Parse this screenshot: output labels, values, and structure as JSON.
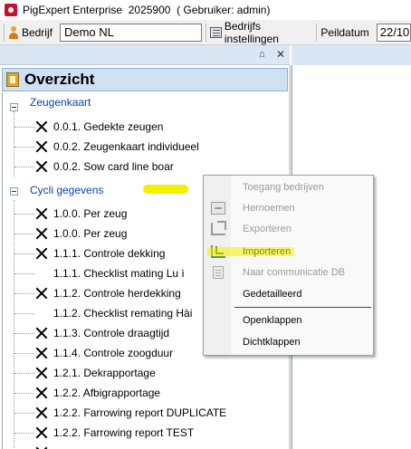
{
  "window": {
    "title": "PigExpert Enterprise  2025900  ( Gebruiker: admin)"
  },
  "toolbar": {
    "company_label": "Bedrijf",
    "company_value": "Demo NL",
    "settings_label": "Bedrijfs instellingen",
    "date_label": "Peildatum",
    "date_value": "22/10"
  },
  "panel": {
    "pin_glyph": "⌂",
    "close_glyph": "✕",
    "title": "Overzicht"
  },
  "tree": {
    "groups": [
      {
        "label": "Zeugenkaart",
        "items": [
          {
            "label": "0.0.1. Gedekte zeugen",
            "icon": "x-icon"
          },
          {
            "label": "0.0.2. Zeugenkaart individueel",
            "icon": "x-icon"
          },
          {
            "label": "0.0.2. Sow card line boar",
            "icon": "x-icon"
          }
        ]
      },
      {
        "label": "Cycli gegevens",
        "items": [
          {
            "label": "1.0.0. Per zeug",
            "icon": "x-icon"
          },
          {
            "label": "1.0.0. Per zeug",
            "icon": "x-icon"
          },
          {
            "label": "1.1.1. Controle dekking",
            "icon": "x-icon"
          },
          {
            "label": "1.1.1. Checklist mating Lu ì",
            "icon": "none"
          },
          {
            "label": "1.1.2. Controle herdekking",
            "icon": "x-icon"
          },
          {
            "label": "1.1.2. Checklist remating Hài",
            "icon": "none"
          },
          {
            "label": "1.1.3. Controle draagtijd",
            "icon": "x-icon"
          },
          {
            "label": "1.1.4. Controle zoogduur",
            "icon": "x-icon"
          },
          {
            "label": "1.2.1. Dekrapportage",
            "icon": "x-icon"
          },
          {
            "label": "1.2.2. Afbigrapportage",
            "icon": "x-icon"
          },
          {
            "label": "1.2.2. Farrowing report DUPLICATE",
            "icon": "x-icon"
          },
          {
            "label": "1.2.2. Farrowing report TEST",
            "icon": "x-icon"
          }
        ]
      }
    ]
  },
  "context_menu": {
    "items": [
      {
        "label": "Toegang bedrijven",
        "disabled": true,
        "icon": ""
      },
      {
        "label": "Hernoemen",
        "disabled": true,
        "icon": "rename-icon"
      },
      {
        "label": "Exporteren",
        "disabled": true,
        "icon": "export-icon"
      },
      {
        "label": "Importeren",
        "disabled": false,
        "icon": "import-icon"
      },
      {
        "label": "Naar communicatie DB",
        "disabled": true,
        "icon": "database-icon"
      },
      {
        "label": "Gedetailleerd",
        "disabled": false,
        "icon": ""
      },
      {
        "label": "Openklappen",
        "disabled": false,
        "icon": ""
      },
      {
        "label": "Dichtklappen",
        "disabled": false,
        "icon": ""
      }
    ]
  },
  "colors": {
    "group_link": "#0645ad",
    "highlight": "#f5f000",
    "panel_header": "#cfe0f3"
  }
}
